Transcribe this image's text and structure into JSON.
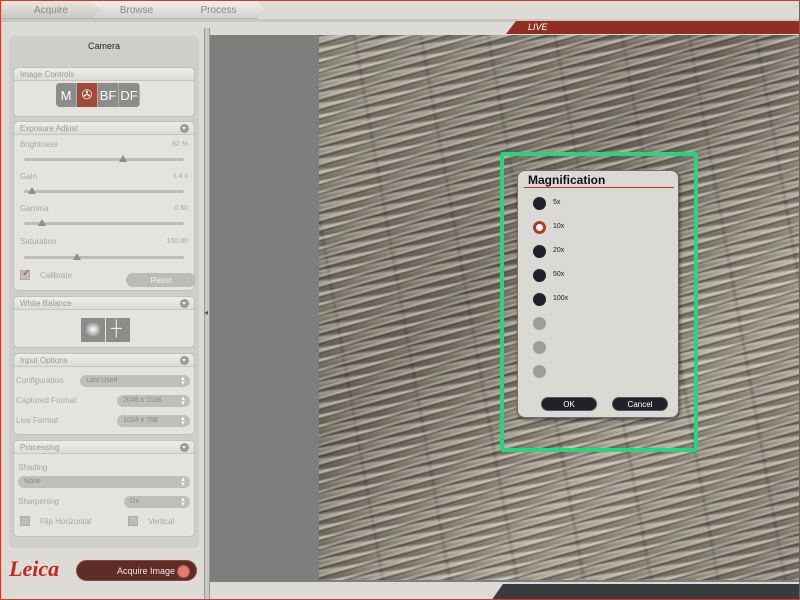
{
  "tabs": [
    {
      "label": "Acquire"
    },
    {
      "label": "Browse"
    },
    {
      "label": "Process"
    }
  ],
  "live_label": "LIVE",
  "left_panel": {
    "title": "Camera",
    "image_controls": {
      "header": "Image Controls",
      "modes": [
        "M",
        "✇",
        "BF",
        "DF"
      ],
      "selected_mode": "fluorescence"
    },
    "exposure": {
      "header": "Exposure Adjust",
      "brightness": {
        "label": "Brightness",
        "value": "82 %",
        "level": 0.62
      },
      "gain": {
        "label": "Gain",
        "value": "1.4 x",
        "level": 0.05
      },
      "gamma": {
        "label": "Gamma",
        "value": "0.60",
        "level": 0.11
      },
      "saturation": {
        "label": "Saturation",
        "value": "100.00",
        "level": 0.33
      },
      "calibrate_label": "Calibrate",
      "calibrate_checked": true,
      "reset_label": "Reset"
    },
    "white_balance": {
      "header": "White Balance"
    },
    "input_options": {
      "header": "Input Options",
      "configuration": {
        "label": "Configuration",
        "value": "Last Used"
      },
      "captured_format": {
        "label": "Captured Format",
        "value": "2048 x 1536"
      },
      "live_format": {
        "label": "Live Format",
        "value": "1024 x 768"
      }
    },
    "processing": {
      "header": "Processing",
      "shading": {
        "label": "Shading",
        "value": "None"
      },
      "sharpening": {
        "label": "Sharpening",
        "value": "On"
      },
      "flip_horizontal": "Flip  Horizontal",
      "flip_vertical": "Vertical"
    }
  },
  "logo": "Leica",
  "acquire_button": "Acquire Image",
  "dialog": {
    "title": "Magnification",
    "options": [
      {
        "label": "5x",
        "state": "normal"
      },
      {
        "label": "10x",
        "state": "selected"
      },
      {
        "label": "20x",
        "state": "normal"
      },
      {
        "label": "50x",
        "state": "normal"
      },
      {
        "label": "100x",
        "state": "normal"
      },
      {
        "label": "",
        "state": "disabled"
      },
      {
        "label": "",
        "state": "disabled"
      },
      {
        "label": "",
        "state": "disabled"
      }
    ],
    "ok_label": "OK",
    "cancel_label": "Cancel"
  },
  "colors": {
    "accent": "#b2382a",
    "selection": "#29d37f",
    "logo": "#c8261c"
  }
}
